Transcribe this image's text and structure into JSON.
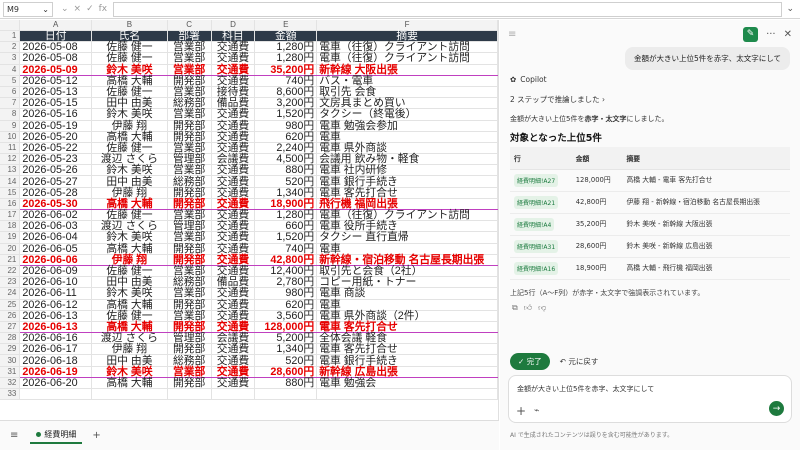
{
  "formula_bar": {
    "cell_ref": "M9",
    "cancel_icon": "×",
    "enter_icon": "✓",
    "fx_label": "fx",
    "formula": ""
  },
  "columns": [
    "",
    "A",
    "B",
    "C",
    "D",
    "E",
    "F"
  ],
  "table_header": [
    "日付",
    "氏名",
    "部署",
    "科目",
    "金額",
    "摘要"
  ],
  "rows": [
    {
      "row": "2",
      "date": "2026-05-08",
      "name": "佐藤 健一",
      "dept": "営業部",
      "item": "交通費",
      "amount": "1,280円",
      "desc": "電車（往復）クライアント訪問",
      "hl": false
    },
    {
      "row": "3",
      "date": "2026-05-08",
      "name": "佐藤 健一",
      "dept": "営業部",
      "item": "交通費",
      "amount": "1,280円",
      "desc": "電車（往復）クライアント訪問",
      "hl": false
    },
    {
      "row": "4",
      "date": "2026-05-09",
      "name": "鈴木 美咲",
      "dept": "営業部",
      "item": "交通費",
      "amount": "35,200円",
      "desc": "新幹線 大阪出張",
      "hl": true
    },
    {
      "row": "5",
      "date": "2026-05-12",
      "name": "高橋 大輔",
      "dept": "開発部",
      "item": "交通費",
      "amount": "740円",
      "desc": "バス・電車",
      "hl": false
    },
    {
      "row": "6",
      "date": "2026-05-13",
      "name": "佐藤 健一",
      "dept": "営業部",
      "item": "接待費",
      "amount": "8,600円",
      "desc": "取引先 会食",
      "hl": false
    },
    {
      "row": "7",
      "date": "2026-05-15",
      "name": "田中 由美",
      "dept": "総務部",
      "item": "備品費",
      "amount": "3,200円",
      "desc": "文房具まとめ買い",
      "hl": false
    },
    {
      "row": "8",
      "date": "2026-05-16",
      "name": "鈴木 美咲",
      "dept": "営業部",
      "item": "交通費",
      "amount": "1,520円",
      "desc": "タクシー（終電後）",
      "hl": false
    },
    {
      "row": "9",
      "date": "2026-05-19",
      "name": "伊藤 翔",
      "dept": "開発部",
      "item": "交通費",
      "amount": "980円",
      "desc": "電車 勉強会参加",
      "hl": false
    },
    {
      "row": "10",
      "date": "2026-05-20",
      "name": "高橋 大輔",
      "dept": "開発部",
      "item": "交通費",
      "amount": "620円",
      "desc": "電車",
      "hl": false
    },
    {
      "row": "11",
      "date": "2026-05-22",
      "name": "佐藤 健一",
      "dept": "営業部",
      "item": "交通費",
      "amount": "2,240円",
      "desc": "電車 県外商談",
      "hl": false
    },
    {
      "row": "12",
      "date": "2026-05-23",
      "name": "渡辺 さくら",
      "dept": "管理部",
      "item": "会議費",
      "amount": "4,500円",
      "desc": "会議用 飲み物・軽食",
      "hl": false
    },
    {
      "row": "13",
      "date": "2026-05-26",
      "name": "鈴木 美咲",
      "dept": "営業部",
      "item": "交通費",
      "amount": "880円",
      "desc": "電車 社内研修",
      "hl": false
    },
    {
      "row": "14",
      "date": "2026-05-27",
      "name": "田中 由美",
      "dept": "総務部",
      "item": "交通費",
      "amount": "520円",
      "desc": "電車 銀行手続き",
      "hl": false
    },
    {
      "row": "15",
      "date": "2026-05-28",
      "name": "伊藤 翔",
      "dept": "開発部",
      "item": "交通費",
      "amount": "1,340円",
      "desc": "電車 客先打合せ",
      "hl": false
    },
    {
      "row": "16",
      "date": "2026-05-30",
      "name": "高橋 大輔",
      "dept": "開発部",
      "item": "交通費",
      "amount": "18,900円",
      "desc": "飛行機 福岡出張",
      "hl": true
    },
    {
      "row": "17",
      "date": "2026-06-02",
      "name": "佐藤 健一",
      "dept": "営業部",
      "item": "交通費",
      "amount": "1,280円",
      "desc": "電車（往復）クライアント訪問",
      "hl": false
    },
    {
      "row": "18",
      "date": "2026-06-03",
      "name": "渡辺 さくら",
      "dept": "管理部",
      "item": "交通費",
      "amount": "660円",
      "desc": "電車 役所手続き",
      "hl": false
    },
    {
      "row": "19",
      "date": "2026-06-04",
      "name": "鈴木 美咲",
      "dept": "営業部",
      "item": "交通費",
      "amount": "1,520円",
      "desc": "タクシー 直行直帰",
      "hl": false
    },
    {
      "row": "20",
      "date": "2026-06-05",
      "name": "高橋 大輔",
      "dept": "開発部",
      "item": "交通費",
      "amount": "740円",
      "desc": "電車",
      "hl": false
    },
    {
      "row": "21",
      "date": "2026-06-06",
      "name": "伊藤 翔",
      "dept": "開発部",
      "item": "交通費",
      "amount": "42,800円",
      "desc": "新幹線・宿泊移動 名古屋長期出張",
      "hl": true
    },
    {
      "row": "22",
      "date": "2026-06-09",
      "name": "佐藤 健一",
      "dept": "営業部",
      "item": "交通費",
      "amount": "12,400円",
      "desc": "取引先と会食（2社）",
      "hl": false
    },
    {
      "row": "23",
      "date": "2026-06-10",
      "name": "田中 由美",
      "dept": "総務部",
      "item": "備品費",
      "amount": "2,780円",
      "desc": "コピー用紙・トナー",
      "hl": false
    },
    {
      "row": "24",
      "date": "2026-06-11",
      "name": "鈴木 美咲",
      "dept": "営業部",
      "item": "交通費",
      "amount": "980円",
      "desc": "電車 商談",
      "hl": false
    },
    {
      "row": "25",
      "date": "2026-06-12",
      "name": "高橋 大輔",
      "dept": "開発部",
      "item": "交通費",
      "amount": "620円",
      "desc": "電車",
      "hl": false
    },
    {
      "row": "26",
      "date": "2026-06-13",
      "name": "佐藤 健一",
      "dept": "営業部",
      "item": "交通費",
      "amount": "3,560円",
      "desc": "電車 県外商談（2件）",
      "hl": false
    },
    {
      "row": "27",
      "date": "2026-06-13",
      "name": "高橋 大輔",
      "dept": "開発部",
      "item": "交通費",
      "amount": "128,000円",
      "desc": "電車 客先打合せ",
      "hl": true
    },
    {
      "row": "28",
      "date": "2026-06-16",
      "name": "渡辺 さくら",
      "dept": "管理部",
      "item": "会議費",
      "amount": "5,200円",
      "desc": "全体会議 軽食",
      "hl": false
    },
    {
      "row": "29",
      "date": "2026-06-17",
      "name": "伊藤 翔",
      "dept": "開発部",
      "item": "交通費",
      "amount": "1,340円",
      "desc": "電車 客先打合せ",
      "hl": false
    },
    {
      "row": "30",
      "date": "2026-06-18",
      "name": "田中 由美",
      "dept": "総務部",
      "item": "交通費",
      "amount": "520円",
      "desc": "電車 銀行手続き",
      "hl": false
    },
    {
      "row": "31",
      "date": "2026-06-19",
      "name": "鈴木 美咲",
      "dept": "営業部",
      "item": "交通費",
      "amount": "28,600円",
      "desc": "新幹線 広島出張",
      "hl": true
    },
    {
      "row": "32",
      "date": "2026-06-20",
      "name": "高橋 大輔",
      "dept": "開発部",
      "item": "交通費",
      "amount": "880円",
      "desc": "電車 勉強会",
      "hl": false
    }
  ],
  "empty_row": "33",
  "sheet_tabs": {
    "menu_icon": "≡",
    "active_tab": "経費明細",
    "add": "+"
  },
  "copilot": {
    "new_chat_icon": "✎",
    "more_icon": "···",
    "close_icon": "✕",
    "menu_icon": "≡",
    "user_message": "金額が大きい上位5件を赤字、太文字にして",
    "assistant_name": "Copilot",
    "reasoning": "2 ステップで推論しました ›",
    "response_pre": "金額が大きい上位5件を",
    "response_bold": "赤字・太文字",
    "response_post": "にしました。",
    "result_title": "対象となった上位5件",
    "result_headers": [
      "行",
      "金額",
      "摘要"
    ],
    "result_rows": [
      {
        "ref": "経費明細!A27",
        "amount": "128,000円",
        "desc": "高橋 大輔 - 電車 客先打合せ"
      },
      {
        "ref": "経費明細!A21",
        "amount": "42,800円",
        "desc": "伊藤 翔 - 新幹線・宿泊移動 名古屋長期出張"
      },
      {
        "ref": "経費明細!A4",
        "amount": "35,200円",
        "desc": "鈴木 美咲 - 新幹線 大阪出張"
      },
      {
        "ref": "経費明細!A31",
        "amount": "28,600円",
        "desc": "鈴木 美咲 - 新幹線 広島出張"
      },
      {
        "ref": "経費明細!A16",
        "amount": "18,900円",
        "desc": "高橋 大輔 - 飛行機 福岡出張"
      }
    ],
    "note": "上記5行（A〜F列）が赤字・太文字で強調表示されています。",
    "done_label": "✓ 完了",
    "undo_label": "↶ 元に戻す",
    "compose_text": "金額が大きい上位5件を赤字、太文字にして",
    "plus_icon": "+",
    "attach_icon": "⌁",
    "send_icon": "→",
    "disclaimer": "AI で生成されたコンテンツは誤りを含む可能性があります。"
  }
}
